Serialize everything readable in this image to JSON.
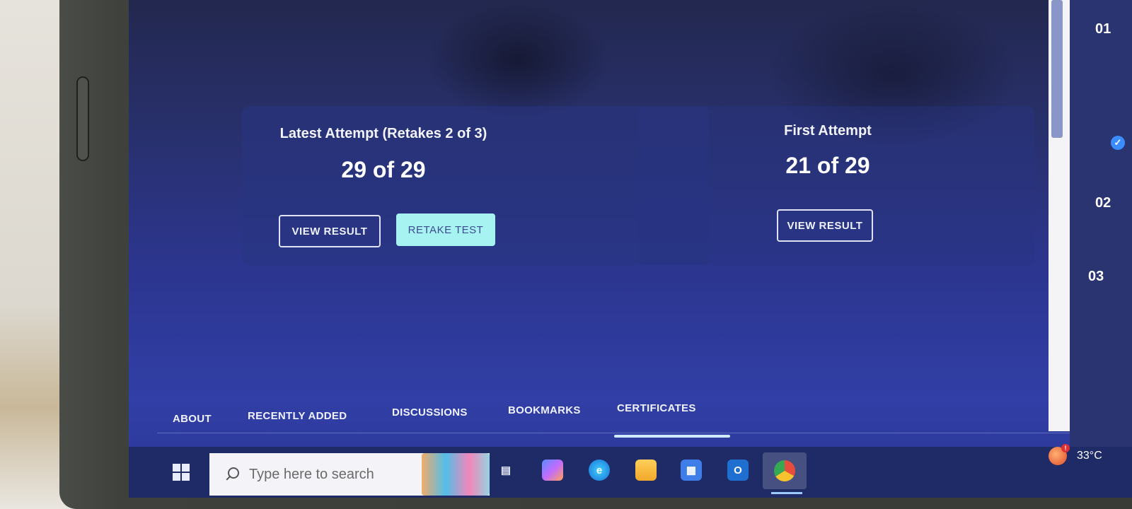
{
  "latest_attempt": {
    "label": "Latest Attempt (Retakes 2 of 3)",
    "score": "29 of 29",
    "view_result_label": "VIEW RESULT",
    "retake_label": "RETAKE TEST"
  },
  "first_attempt": {
    "label": "First Attempt",
    "score": "21 of 29",
    "view_result_label": "VIEW RESULT"
  },
  "side_steps": [
    "01",
    "02",
    "03"
  ],
  "tabs": [
    {
      "label": "ABOUT"
    },
    {
      "label": "RECENTLY ADDED"
    },
    {
      "label": "DISCUSSIONS"
    },
    {
      "label": "BOOKMARKS"
    },
    {
      "label": "CERTIFICATES",
      "active": true
    }
  ],
  "taskbar": {
    "search_placeholder": "Type here to search",
    "apps": [
      "task-view-icon",
      "copilot-icon",
      "edge-icon",
      "file-explorer-icon",
      "store-icon",
      "outlook-icon",
      "chrome-icon"
    ],
    "temperature": "33°C"
  },
  "colors": {
    "screen_bg": "#2c3690",
    "retake_button_bg": "#a7f3f2",
    "tab_underline": "#cfe9ff"
  }
}
